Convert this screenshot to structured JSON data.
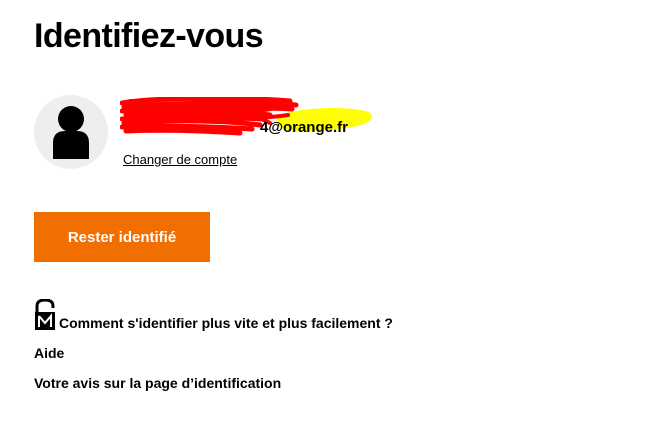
{
  "page": {
    "title": "Identifiez-vous"
  },
  "account": {
    "avatar_icon": "user-avatar-icon",
    "email_visible": "4@orange.fr",
    "change_account_label": "Changer de compte"
  },
  "actions": {
    "stay_signed_in_label": "Rester identifié"
  },
  "help": {
    "lock_icon": "open-lock-icon",
    "faster_sign_in_label": "Comment s'identifier plus vite et plus facilement ?",
    "aide_label": "Aide",
    "feedback_label": "Votre avis sur la page d’identification"
  },
  "colors": {
    "brand_orange": "#f16e00",
    "avatar_background": "#eeeeee",
    "redaction_red": "#ff0000",
    "highlight_yellow": "#ffff00",
    "text": "#000000"
  }
}
